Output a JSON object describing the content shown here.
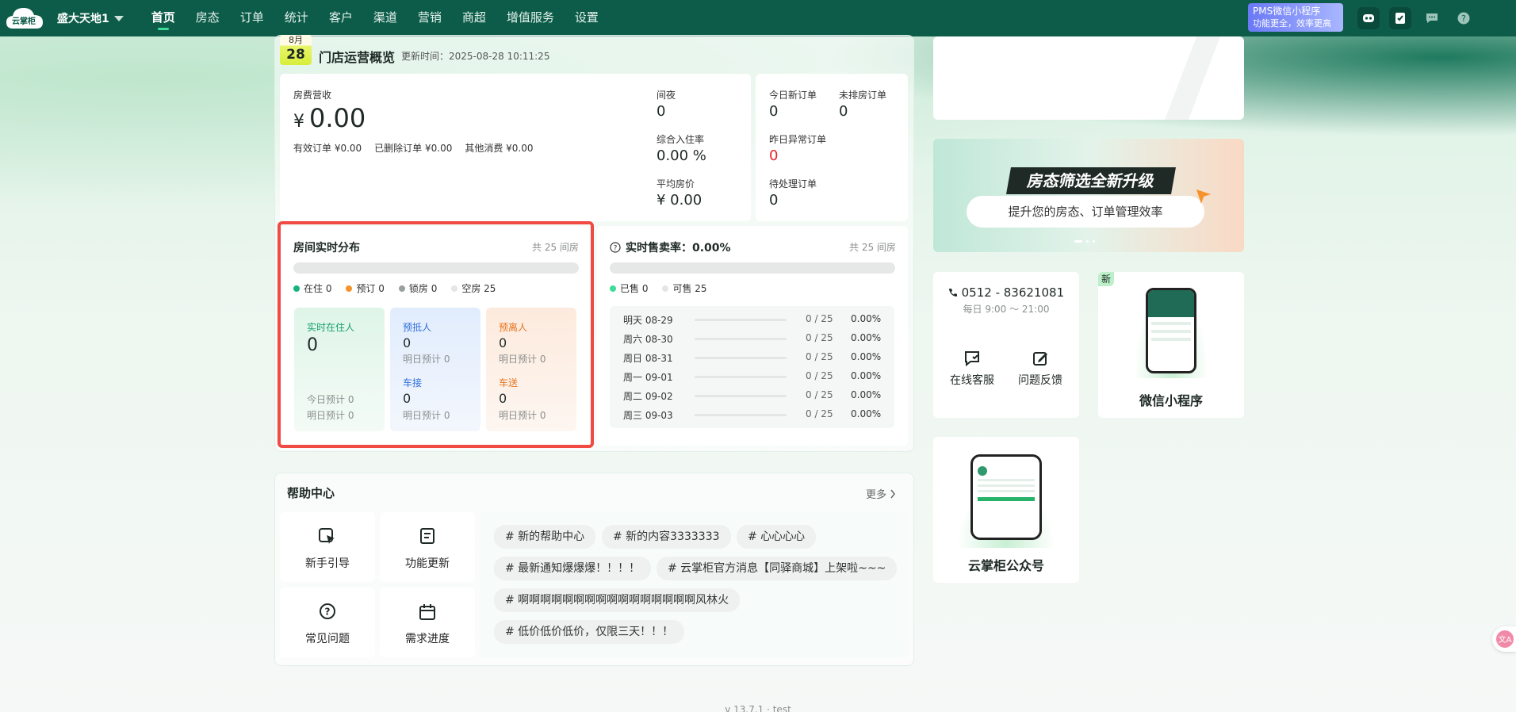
{
  "nav": {
    "logo_text": "云掌柜",
    "store_name": "盛大天地1",
    "menu": [
      "首页",
      "房态",
      "订单",
      "统计",
      "客户",
      "渠道",
      "营销",
      "商超",
      "增值服务",
      "设置"
    ],
    "mini_banner_line1": "PMS微信小程序",
    "mini_banner_line2": "功能更全，效率更高"
  },
  "overview": {
    "month": "8月",
    "day": "28",
    "title": "门店运营概览",
    "updated": "更新时间：2025-08-28 10:11:25",
    "revenue_label": "房费营收",
    "revenue_currency": "¥",
    "revenue_value": "0.00",
    "valid_orders": "有效订单 ¥0.00",
    "deleted_orders": "已删除订单 ¥0.00",
    "other_consumption": "其他消费 ¥0.00",
    "room_nights_label": "间夜",
    "room_nights_value": "0",
    "occupancy_label": "综合入住率",
    "occupancy_value": "0.00 %",
    "avg_price_label": "平均房价",
    "avg_price_value": "¥ 0.00",
    "today_new_label": "今日新订单",
    "today_new_value": "0",
    "unassigned_label": "未排房订单",
    "unassigned_value": "0",
    "yesterday_abnormal_label": "昨日异常订单",
    "yesterday_abnormal_value": "0",
    "pending_label": "待处理订单",
    "pending_value": "0"
  },
  "distribution": {
    "title": "房间实时分布",
    "total": "共 25 间房",
    "legend": [
      {
        "label": "在住 0",
        "color": "#17b37e"
      },
      {
        "label": "预订 0",
        "color": "#f5922b"
      },
      {
        "label": "锁房 0",
        "color": "#9aa09e"
      },
      {
        "label": "空房 25",
        "color": "#e3e6e5"
      }
    ],
    "in_house_label": "实时在住人",
    "in_house_value": "0",
    "in_house_today": "今日预计 0",
    "in_house_tomorrow": "明日预计 0",
    "arriving_label": "预抵人",
    "arriving_value": "0",
    "arriving_tomorrow": "明日预计 0",
    "pickup_label": "车接",
    "pickup_value": "0",
    "pickup_tomorrow": "明日预计 0",
    "departing_label": "预离人",
    "departing_value": "0",
    "departing_tomorrow": "明日预计 0",
    "dropoff_label": "车送",
    "dropoff_value": "0",
    "dropoff_tomorrow": "明日预计 0"
  },
  "sales": {
    "title": "实时售卖率：0.00%",
    "total": "共 25 间房",
    "legend": [
      {
        "label": "已售 0",
        "color": "#3ddc97"
      },
      {
        "label": "可售 25",
        "color": "#e3e6e5"
      }
    ],
    "rows": [
      {
        "day": "明天 08-29",
        "count": "0 / 25",
        "rate": "0.00%"
      },
      {
        "day": "周六 08-30",
        "count": "0 / 25",
        "rate": "0.00%"
      },
      {
        "day": "周日 08-31",
        "count": "0 / 25",
        "rate": "0.00%"
      },
      {
        "day": "周一 09-01",
        "count": "0 / 25",
        "rate": "0.00%"
      },
      {
        "day": "周二 09-02",
        "count": "0 / 25",
        "rate": "0.00%"
      },
      {
        "day": "周三 09-03",
        "count": "0 / 25",
        "rate": "0.00%"
      }
    ]
  },
  "help": {
    "title": "帮助中心",
    "more": "更多",
    "tiles": [
      "新手引导",
      "功能更新",
      "常见问题",
      "需求进度"
    ],
    "tags": [
      "# 新的帮助中心",
      "# 新的内容3333333",
      "# 心心心心",
      "# 最新通知爆爆爆！！！！",
      "# 云掌柜官方消息【同驿商城】上架啦~~~",
      "# 啊啊啊啊啊啊啊啊啊啊啊啊啊啊啊啊风林火",
      "# 低价低价低价，仅限三天！！！"
    ]
  },
  "side": {
    "banner_title": "房态筛选全新升级",
    "banner_sub": "提升您的房态、订单管理效率",
    "phone": "0512 - 83621081",
    "hours": "每日 9:00 ～ 21:00",
    "online_service": "在线客服",
    "feedback": "问题反馈",
    "new_badge": "新",
    "mini_program": "微信小程序",
    "official_account": "云掌柜公众号"
  },
  "footer": {
    "version": "v 13.7.1 · test"
  },
  "colors": {
    "brand": "#0d5c49",
    "accent": "#3ddc97",
    "alert": "#e8222b",
    "highlight_box": "#f04a42"
  }
}
